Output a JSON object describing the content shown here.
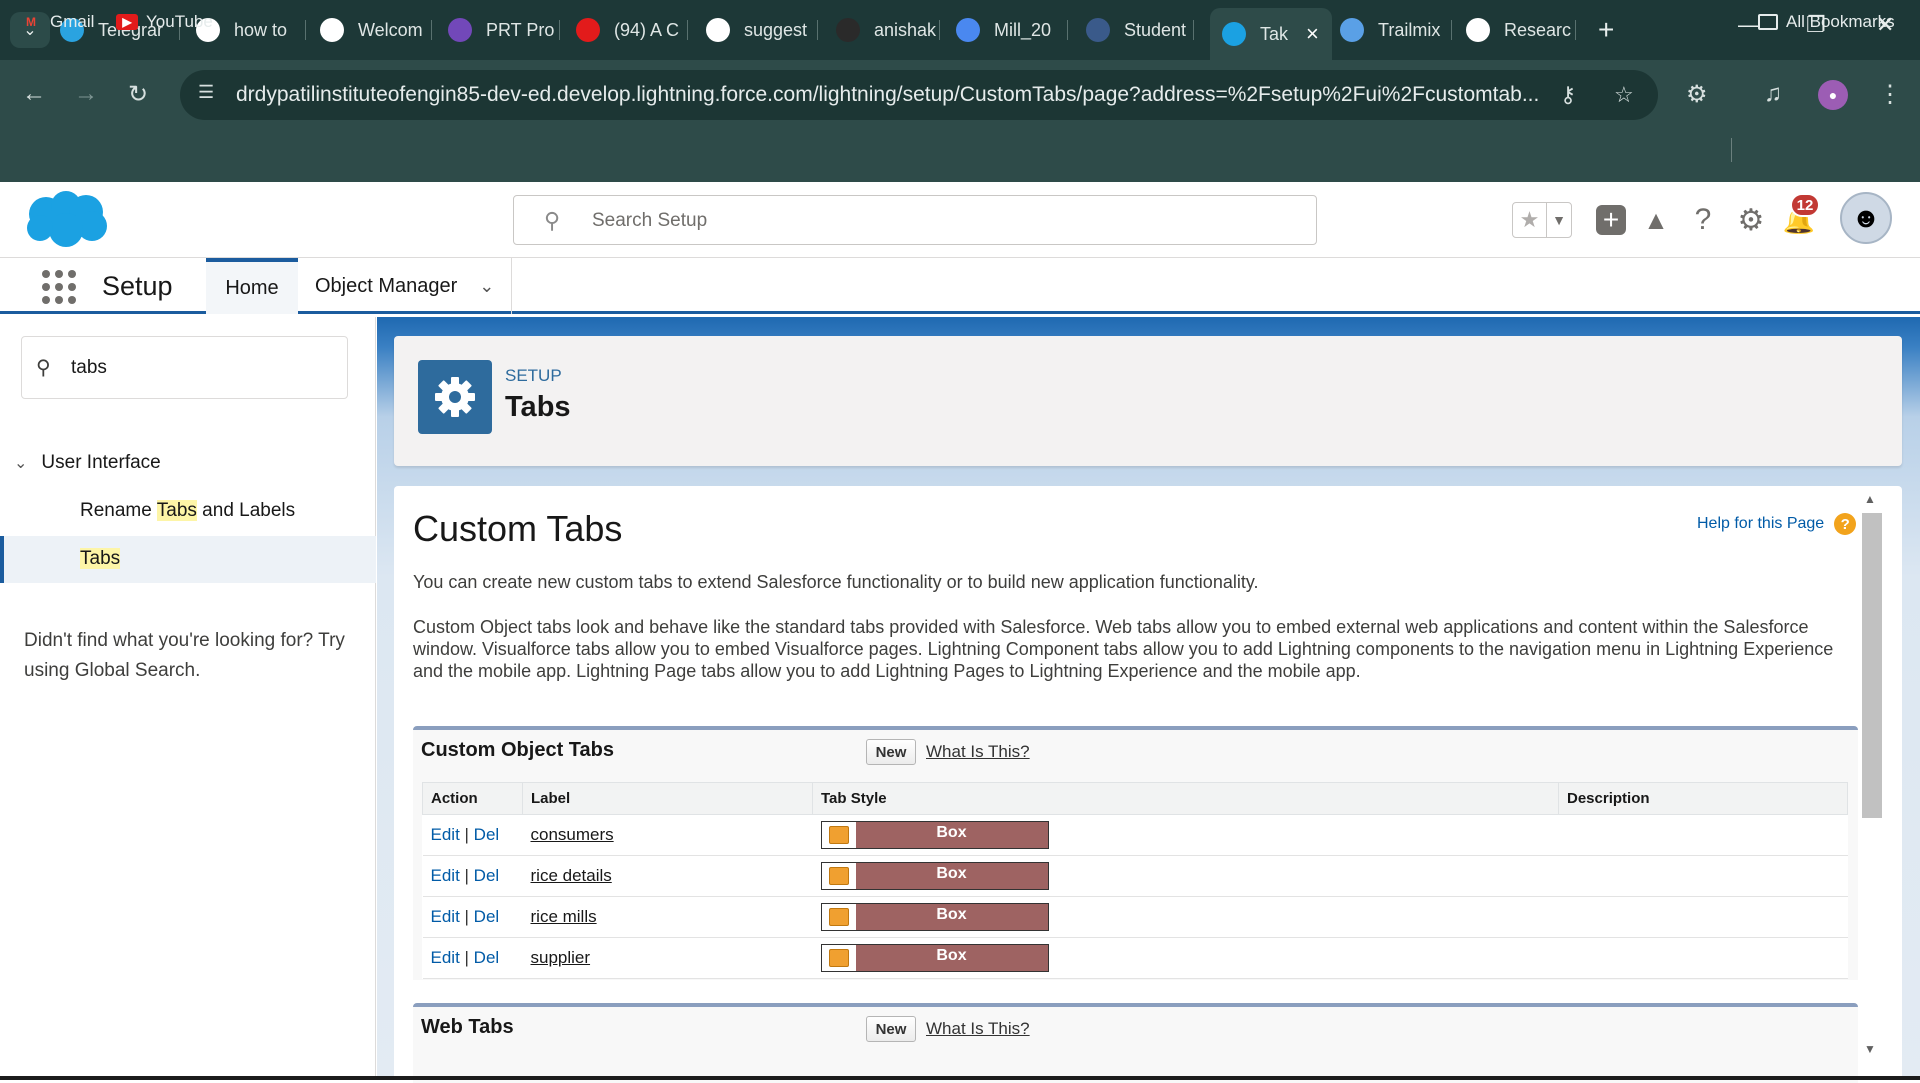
{
  "browser": {
    "tabs": [
      {
        "label": "Telegrar",
        "icon": "telegram-icon",
        "color": "#2aa3e0"
      },
      {
        "label": "how to",
        "icon": "google-icon",
        "color": "#ffffff"
      },
      {
        "label": "Welcom",
        "icon": "gmail-icon",
        "color": "#ffffff"
      },
      {
        "label": "PRT Pro",
        "icon": "form-icon",
        "color": "#7248b9"
      },
      {
        "label": "(94) A C",
        "icon": "youtube-icon",
        "color": "#e21b1b"
      },
      {
        "label": "suggest",
        "icon": "google-icon",
        "color": "#ffffff"
      },
      {
        "label": "anishak",
        "icon": "github-icon",
        "color": "#2a2a2a"
      },
      {
        "label": "Mill_20",
        "icon": "docs-icon",
        "color": "#4a88f0"
      },
      {
        "label": "Student",
        "icon": "page-icon",
        "color": "#3a5a8a"
      },
      {
        "label": "Tak",
        "icon": "salesforce-icon",
        "color": "#1ba1e2"
      },
      {
        "label": "Trailmix",
        "icon": "trailhead-icon",
        "color": "#5aa0e6"
      },
      {
        "label": "Researc",
        "icon": "openai-icon",
        "color": "#ffffff"
      }
    ],
    "url": "drdypatilinstituteofengin85-dev-ed.develop.lightning.force.com/lightning/setup/CustomTabs/page?address=%2Fsetup%2Fui%2Fcustomtab...",
    "bookmarks": [
      {
        "label": "Gmail",
        "icon": "gmail-icon"
      },
      {
        "label": "YouTube",
        "icon": "youtube-icon"
      }
    ],
    "all_bookmarks": "All Bookmarks"
  },
  "sf_header": {
    "search_placeholder": "Search Setup",
    "notification_count": "12"
  },
  "sf_nav": {
    "app_name": "Setup",
    "home": "Home",
    "object_manager": "Object Manager"
  },
  "sidebar": {
    "quick_find_value": "tabs",
    "group": "User Interface",
    "items": [
      {
        "pre": "Rename ",
        "highlight": "Tabs",
        "post": " and Labels"
      },
      {
        "pre": "",
        "highlight": "Tabs",
        "post": ""
      }
    ],
    "help_text": "Didn't find what you're looking for? Try using Global Search."
  },
  "page_header": {
    "eyebrow": "SETUP",
    "title": "Tabs"
  },
  "content": {
    "title": "Custom Tabs",
    "help_link": "Help for this Page",
    "intro": "You can create new custom tabs to extend Salesforce functionality or to build new application functionality.",
    "description": "Custom Object tabs look and behave like the standard tabs provided with Salesforce. Web tabs allow you to embed external web applications and content within the Salesforce window. Visualforce tabs allow you to embed Visualforce pages. Lightning Component tabs allow you to add Lightning components to the navigation menu in Lightning Experience and the mobile app. Lightning Page tabs allow you to add Lightning Pages to Lightning Experience and the mobile app.",
    "custom_object_tabs": {
      "title": "Custom Object Tabs",
      "new_label": "New",
      "what_label": "What Is This?",
      "columns": [
        "Action",
        "Label",
        "Tab Style",
        "Description"
      ],
      "rows": [
        {
          "edit": "Edit",
          "del": "Del",
          "label": "consumers",
          "style": "Box",
          "description": ""
        },
        {
          "edit": "Edit",
          "del": "Del",
          "label": "rice details",
          "style": "Box",
          "description": ""
        },
        {
          "edit": "Edit",
          "del": "Del",
          "label": "rice mills",
          "style": "Box",
          "description": ""
        },
        {
          "edit": "Edit",
          "del": "Del",
          "label": "supplier",
          "style": "Box",
          "description": ""
        }
      ]
    },
    "web_tabs": {
      "title": "Web Tabs",
      "new_label": "New",
      "what_label": "What Is This?"
    }
  },
  "colors": {
    "browser_dark": "#1d3837",
    "browser_toolbar": "#2e4b49",
    "salesforce_blue": "#1b5c9e",
    "link_blue": "#015ba7",
    "tab_style_box": "#9e6362"
  }
}
